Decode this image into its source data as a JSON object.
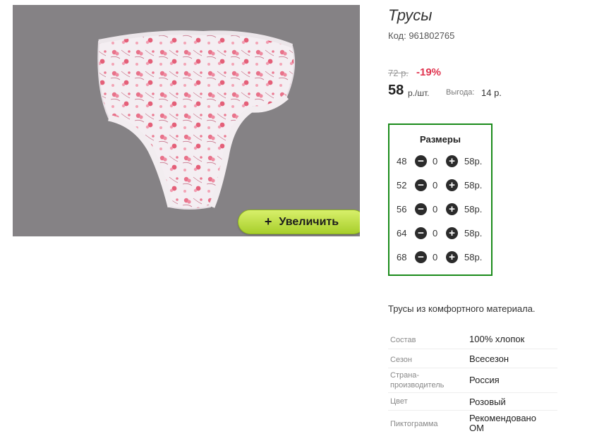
{
  "product": {
    "title": "Трусы",
    "code": "Код: 961802765",
    "old_price": "72 р.",
    "discount": "-19%",
    "price": "58",
    "price_unit": "р./шт.",
    "benefit_label": "Выгода:",
    "benefit_value": "14 р."
  },
  "image": {
    "zoom_label": "Увеличить",
    "zoom_plus": "+",
    "background_color": "#858285",
    "button_color": "#b5d83a"
  },
  "sizes": {
    "title": "Размеры",
    "border_color": "#1a8b1a",
    "rows": [
      {
        "size": "48",
        "qty": "0",
        "price": "58р."
      },
      {
        "size": "52",
        "qty": "0",
        "price": "58р."
      },
      {
        "size": "56",
        "qty": "0",
        "price": "58р."
      },
      {
        "size": "64",
        "qty": "0",
        "price": "58р."
      },
      {
        "size": "68",
        "qty": "0",
        "price": "58р."
      }
    ]
  },
  "description": "Трусы из комфортного материала.",
  "properties": [
    {
      "label": "Состав",
      "value": "100% хлопок"
    },
    {
      "label": "Сезон",
      "value": "Всесезон"
    },
    {
      "label": "Страна-производитель",
      "value": "Россия"
    },
    {
      "label": "Цвет",
      "value": "Розовый"
    },
    {
      "label": "Пиктограмма",
      "value": "Рекомендовано ОМ"
    }
  ],
  "accent_colors": {
    "discount": "#e0344f"
  }
}
